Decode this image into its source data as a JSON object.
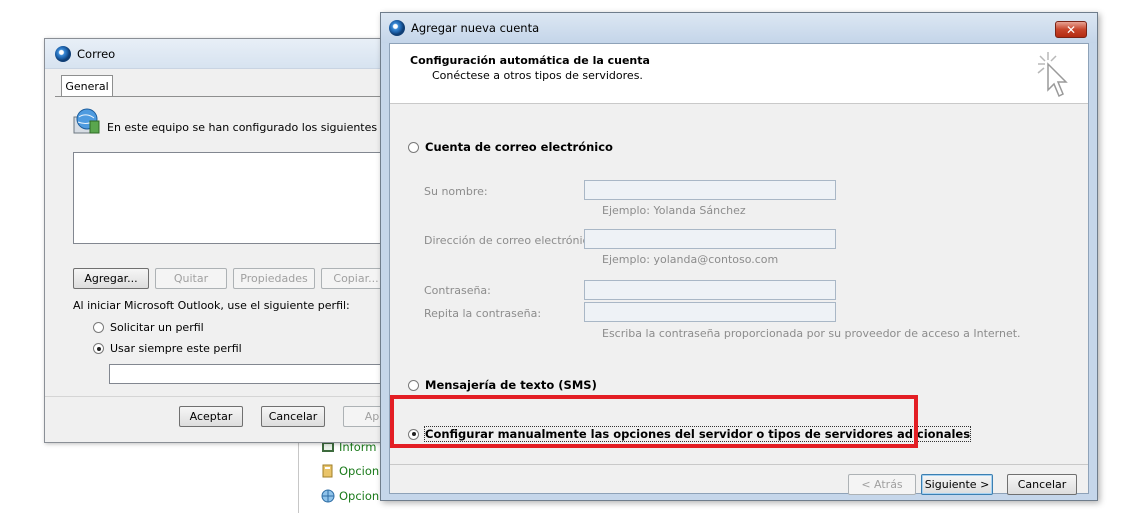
{
  "background_window": {
    "items": [
      {
        "label": "Inform",
        "icon": "info-book-icon"
      },
      {
        "label": "Opcion",
        "icon": "folder-options-icon"
      },
      {
        "label": "Opcion",
        "icon": "globe-options-icon"
      }
    ]
  },
  "correo": {
    "title": "Correo",
    "tab_label": "General",
    "intro_text": "En este equipo se han configurado los siguientes perfiles",
    "buttons": {
      "add": "Agregar...",
      "remove": "Quitar",
      "properties": "Propiedades",
      "copy": "Copiar..."
    },
    "startup_label": "Al iniciar Microsoft Outlook, use el siguiente perfil:",
    "radio_prompt": "Solicitar un perfil",
    "radio_always": "Usar siempre este perfil",
    "selected_profile": "",
    "ok": "Aceptar",
    "cancel": "Cancelar",
    "apply": "Apli"
  },
  "wizard": {
    "title": "Agregar nueva cuenta",
    "close_glyph": "✕",
    "header_title": "Configuración automática de la cuenta",
    "header_subtitle": "Conéctese a otros tipos de servidores.",
    "option_email": "Cuenta de correo electrónico",
    "fields": {
      "name_label": "Su nombre:",
      "name_value": "",
      "name_hint": "Ejemplo: Yolanda Sánchez",
      "email_label": "Dirección de correo electrónico:",
      "email_value": "",
      "email_hint": "Ejemplo: yolanda@contoso.com",
      "password_label": "Contraseña:",
      "password_value": "",
      "repeat_label": "Repita la contraseña:",
      "repeat_value": "",
      "password_hint": "Escriba la contraseña proporcionada por su proveedor de acceso a Internet."
    },
    "option_sms": "Mensajería de texto (SMS)",
    "option_manual": "Configurar manualmente las opciones del servidor o tipos de servidores adicionales",
    "selected_option": "manual",
    "buttons": {
      "back": "< Atrás",
      "next": "Siguiente >",
      "cancel": "Cancelar"
    }
  },
  "colors": {
    "highlight": "#e31e24",
    "close_button": "#c7452b",
    "green_link": "#1a7a1a"
  }
}
